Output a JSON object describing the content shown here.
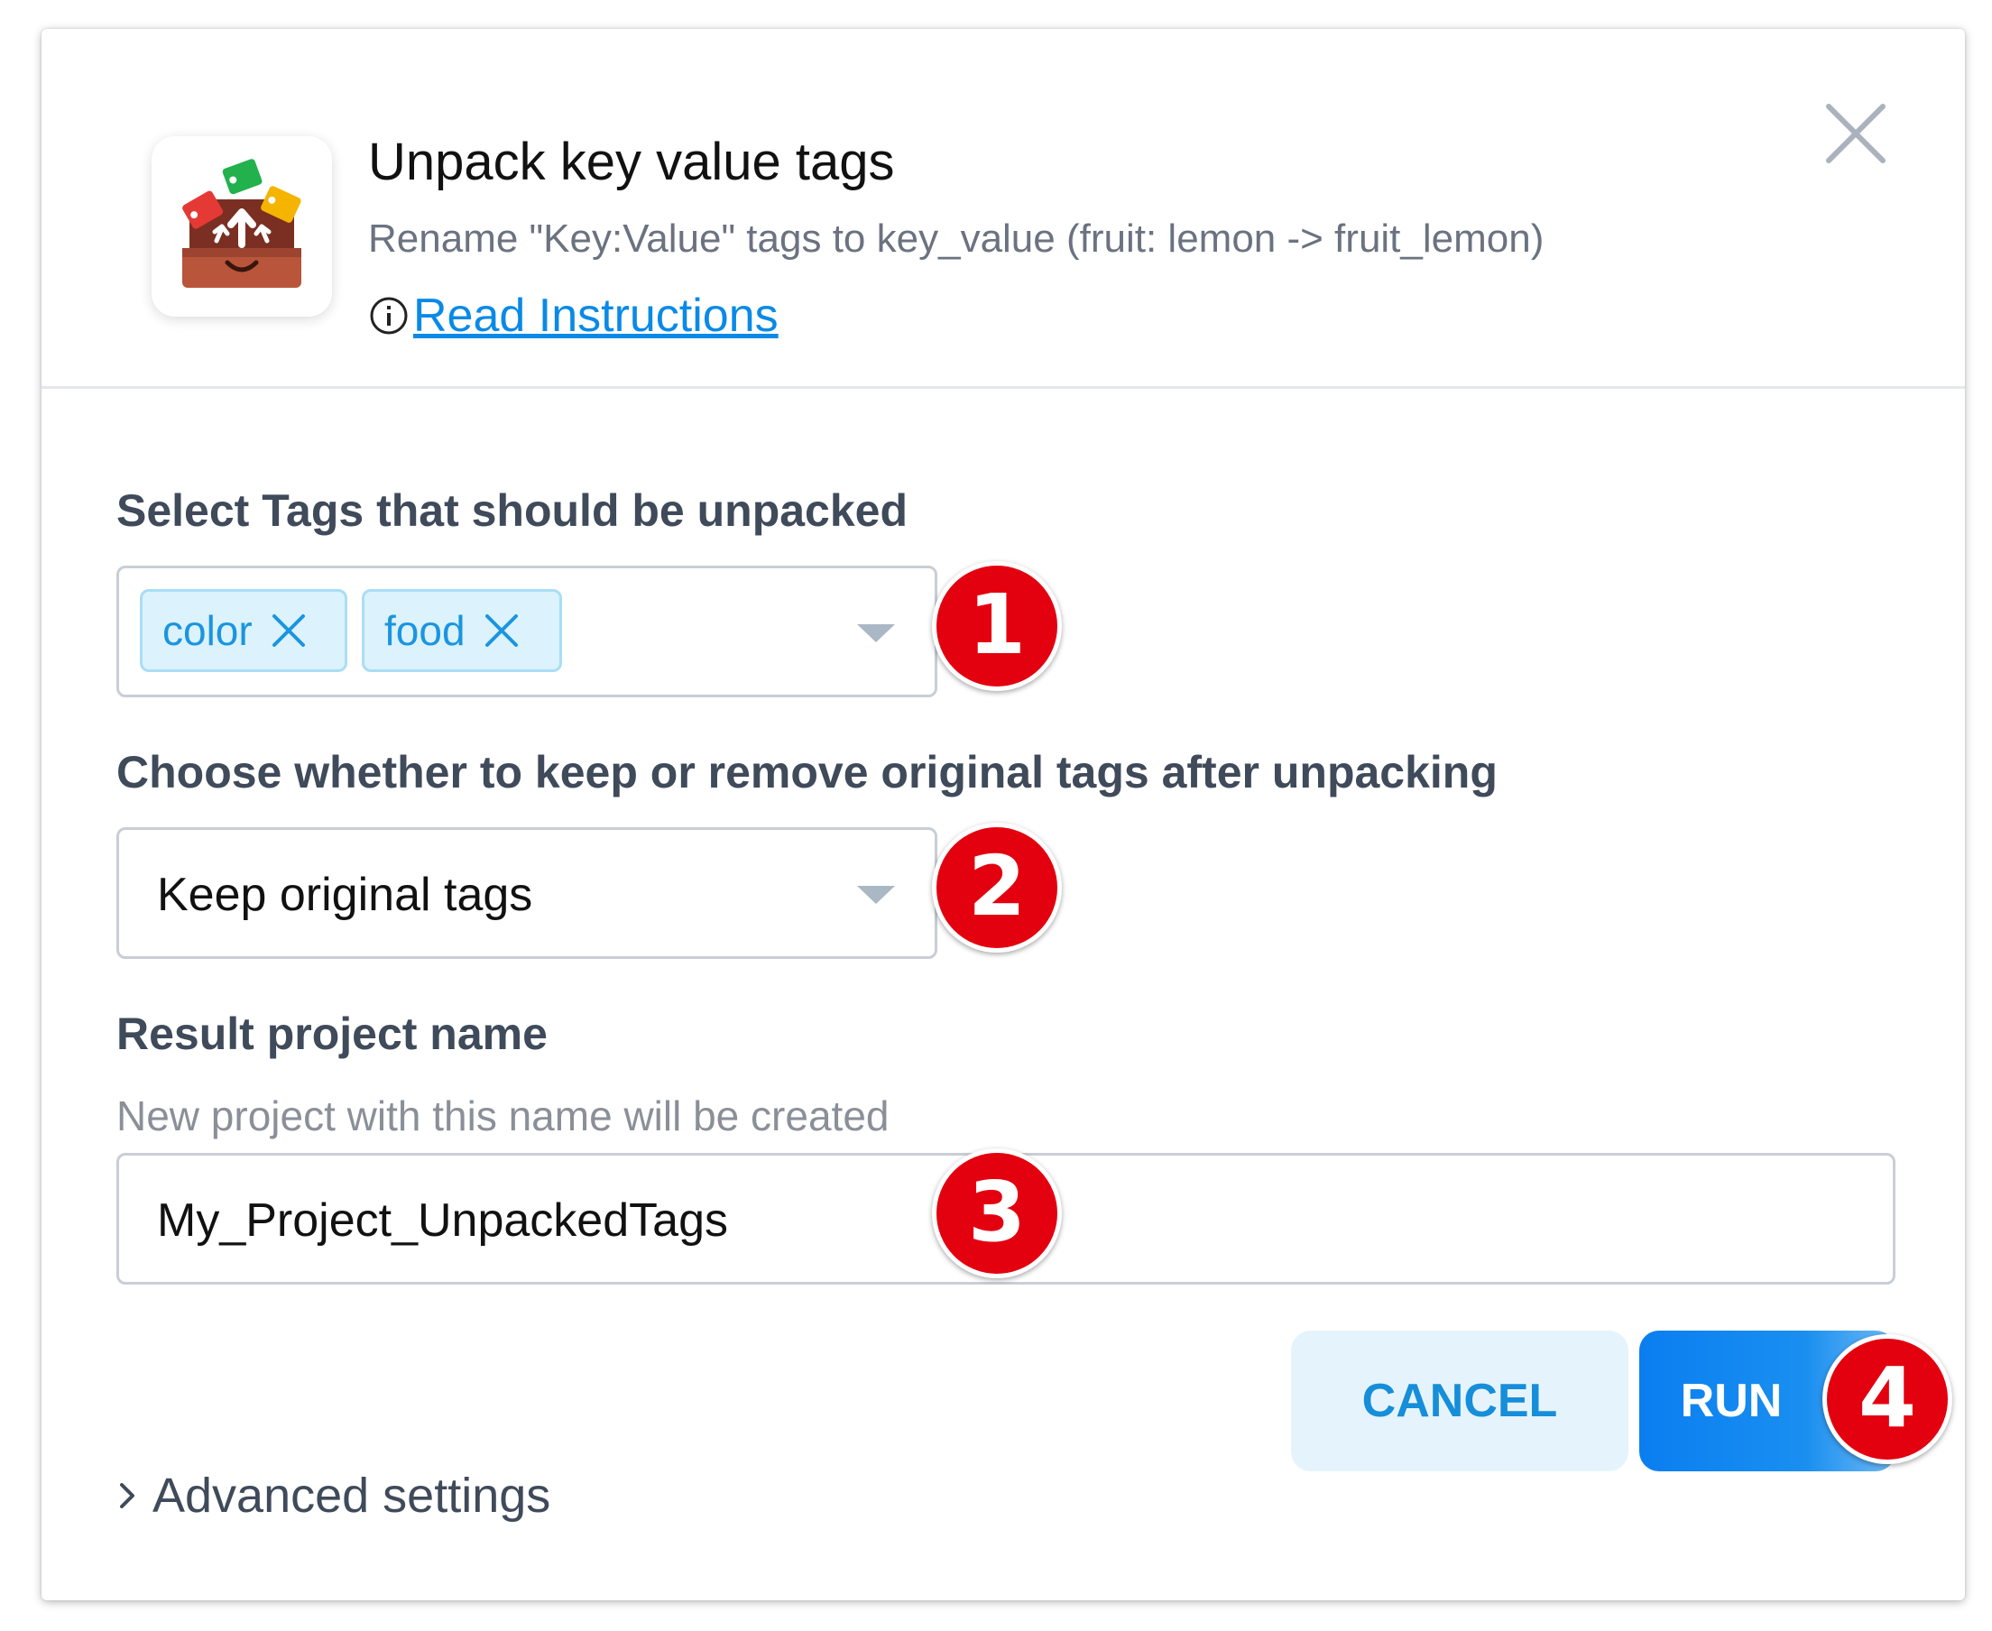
{
  "dialog": {
    "title": "Unpack key value tags",
    "subtitle": "Rename \"Key:Value\" tags to key_value (fruit: lemon -> fruit_lemon)",
    "instructions_link": "Read Instructions",
    "app_icon": "unpack-box-icon",
    "close_icon": "close-icon"
  },
  "form": {
    "tags_field": {
      "label": "Select Tags that should be unpacked",
      "selected_tags": [
        "color",
        "food"
      ],
      "badge": "1"
    },
    "keep_field": {
      "label": "Choose whether to keep or remove original tags after unpacking",
      "value": "Keep original tags",
      "badge": "2"
    },
    "project_field": {
      "label": "Result project name",
      "hint": "New project with this name will be created",
      "value": "My_Project_UnpackedTags",
      "badge": "3"
    }
  },
  "actions": {
    "cancel_label": "CANCEL",
    "run_label": "RUN",
    "run_badge": "4"
  },
  "advanced": {
    "label": "Advanced settings"
  },
  "colors": {
    "accent": "#0a8ae6",
    "badge": "#e3000f",
    "tag_bg": "#dcf2fc",
    "label": "#3f4a5a"
  }
}
